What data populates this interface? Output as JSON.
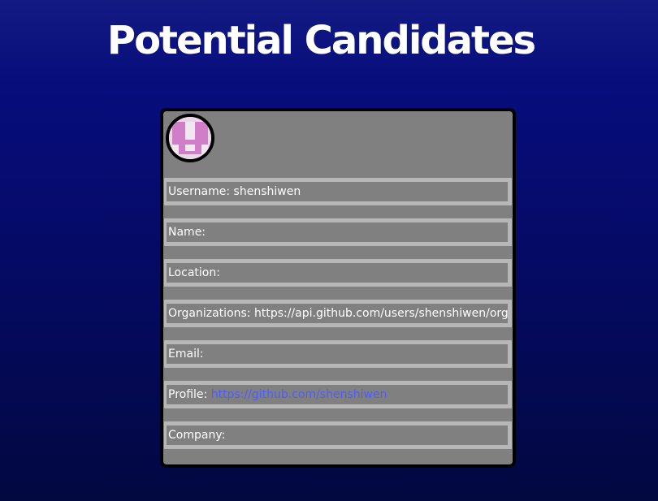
{
  "page": {
    "title": "Potential Candidates"
  },
  "candidate": {
    "avatar_icon": "identicon-avatar",
    "fields": [
      {
        "label": "Username:",
        "value": "shenshiwen"
      },
      {
        "label": "Name:",
        "value": ""
      },
      {
        "label": "Location:",
        "value": ""
      },
      {
        "label": "Organizations:",
        "value": "https://api.github.com/users/shenshiwen/orgs"
      },
      {
        "label": "Email:",
        "value": ""
      },
      {
        "label": "Profile:",
        "value": "https://github.com/shenshiwen"
      },
      {
        "label": "Company:",
        "value": ""
      }
    ]
  },
  "colors": {
    "background_top": "#131a82",
    "background_bottom": "#020840",
    "card_background": "#808080",
    "field_separator": "#b7b7b7",
    "link": "#4e5cff",
    "avatar_pink": "#d17ec8"
  }
}
